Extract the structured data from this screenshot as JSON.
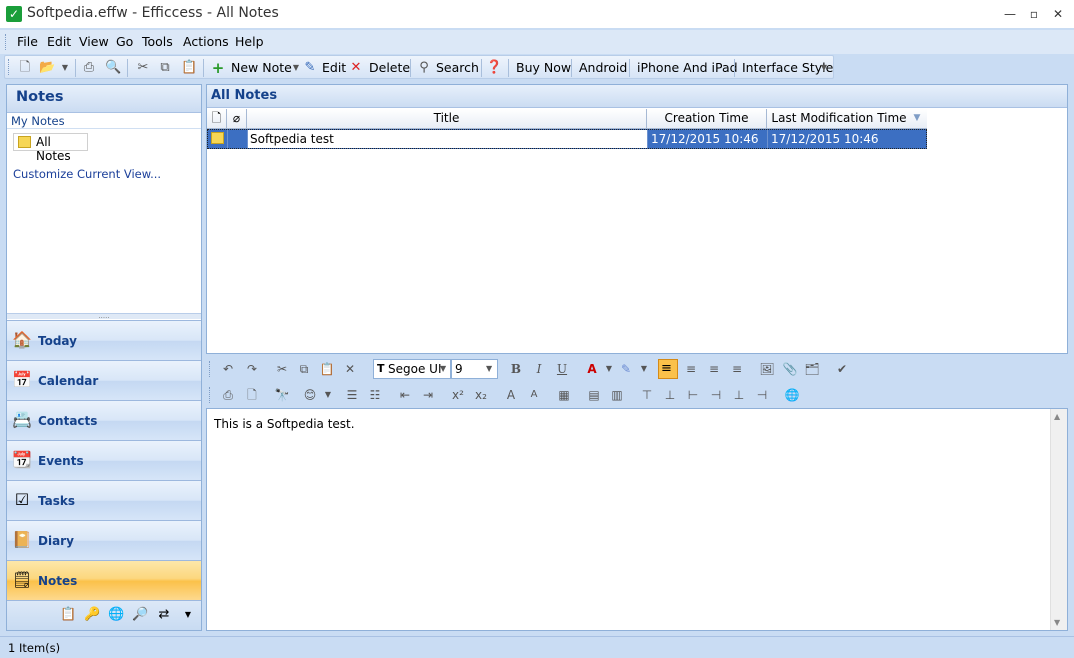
{
  "app": {
    "title": "Softpedia.effw - Efficcess",
    "view": "All Notes",
    "title_sep": " - "
  },
  "menu": [
    "File",
    "Edit",
    "View",
    "Go",
    "Tools",
    "Actions",
    "Help"
  ],
  "toolbar": {
    "new_note": "New Note",
    "edit": "Edit",
    "delete": "Delete",
    "search": "Search",
    "buy_now": "Buy Now",
    "android": "Android",
    "iphone": "iPhone And iPad",
    "interface_style": "Interface Style"
  },
  "left": {
    "header": "Notes",
    "group": "My Notes",
    "item": "All Notes",
    "customize": "Customize Current View...",
    "nav": [
      {
        "label": "Today",
        "icon": "home-icon"
      },
      {
        "label": "Calendar",
        "icon": "calendar-icon"
      },
      {
        "label": "Contacts",
        "icon": "contacts-icon"
      },
      {
        "label": "Events",
        "icon": "events-icon"
      },
      {
        "label": "Tasks",
        "icon": "tasks-icon"
      },
      {
        "label": "Diary",
        "icon": "diary-icon"
      },
      {
        "label": "Notes",
        "icon": "notes-icon"
      }
    ]
  },
  "main": {
    "header": "All Notes",
    "columns": [
      "Title",
      "Creation Time",
      "Last Modification Time"
    ],
    "rows": [
      {
        "title": "Softpedia test",
        "created": "17/12/2015 10:46",
        "modified": "17/12/2015 10:46"
      }
    ]
  },
  "editor": {
    "font": "Segoe UI",
    "size": "9",
    "content": "This is a Softpedia test."
  },
  "status": "1 Item(s)"
}
